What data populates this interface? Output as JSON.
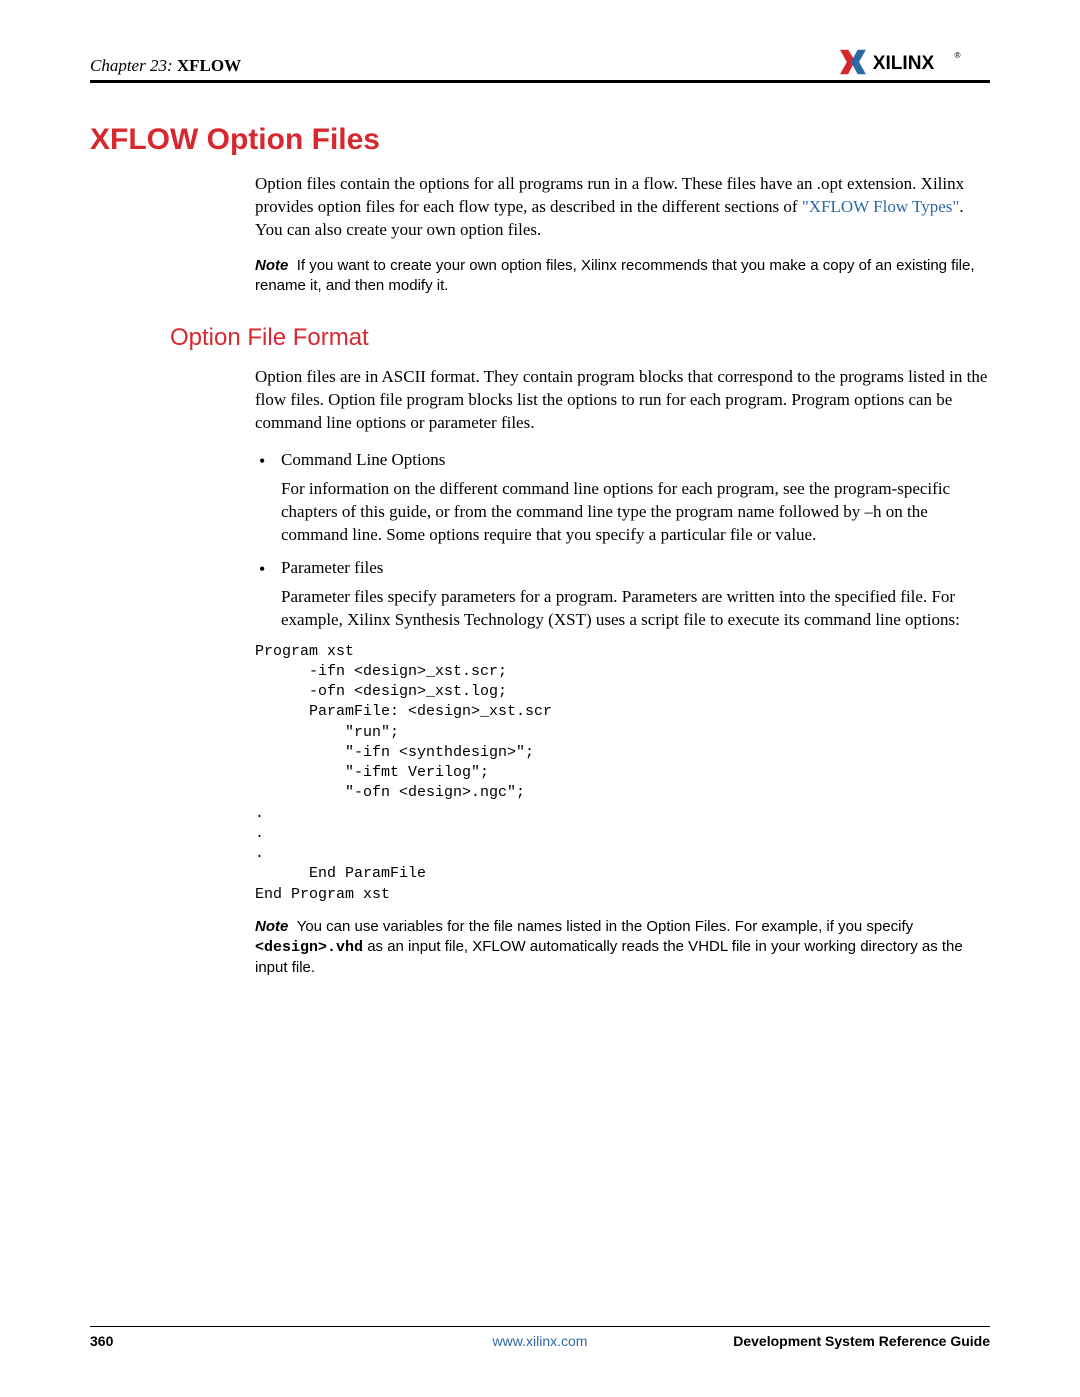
{
  "header": {
    "chapter_prefix": "Chapter 23:",
    "chapter_title": "XFLOW",
    "brand": "XILINX",
    "reg": "®"
  },
  "h1": "XFLOW Option Files",
  "intro": {
    "p1_a": "Option files contain the options for all programs run in a flow. These files have an .opt extension. Xilinx provides option files for each flow type, as described in the different sections of ",
    "p1_link": "\"XFLOW Flow Types\"",
    "p1_b": ". You can also create your own option files."
  },
  "note1": {
    "label": "Note",
    "text": "If you want to create your own option files, Xilinx recommends that you make a copy of an existing file, rename it, and then modify it."
  },
  "h2": "Option File Format",
  "format_intro": "Option files are in ASCII format. They contain program blocks that correspond to the programs listed in the flow files. Option file program blocks list the options to run for each program. Program options can be command line options or parameter files.",
  "bullets": [
    {
      "title": "Command Line Options",
      "body": "For information on the different command line options for each program, see the program-specific chapters of this guide, or from the command line type the program name followed by –h on the command line. Some options require that you specify a particular file or value."
    },
    {
      "title": "Parameter files",
      "body": "Parameter files specify parameters for a program. Parameters are written into the specified file. For example, Xilinx Synthesis Technology (XST) uses a script file to execute its command line options:"
    }
  ],
  "code": "Program xst\n      -ifn <design>_xst.scr;\n      -ofn <design>_xst.log;\n      ParamFile: <design>_xst.scr\n          \"run\";\n          \"-ifn <synthdesign>\";\n          \"-ifmt Verilog\";\n          \"-ofn <design>.ngc\";\n.\n.\n.\n      End ParamFile\nEnd Program xst",
  "note2": {
    "label": "Note",
    "text_a": "You can use variables for the file names listed in the Option Files. For example, if you specify ",
    "mono": "<design>.vhd",
    "text_b": " as an input file, XFLOW automatically reads the VHDL file in your working directory as the input file."
  },
  "footer": {
    "page": "360",
    "url": "www.xilinx.com",
    "doc": "Development System Reference Guide"
  }
}
